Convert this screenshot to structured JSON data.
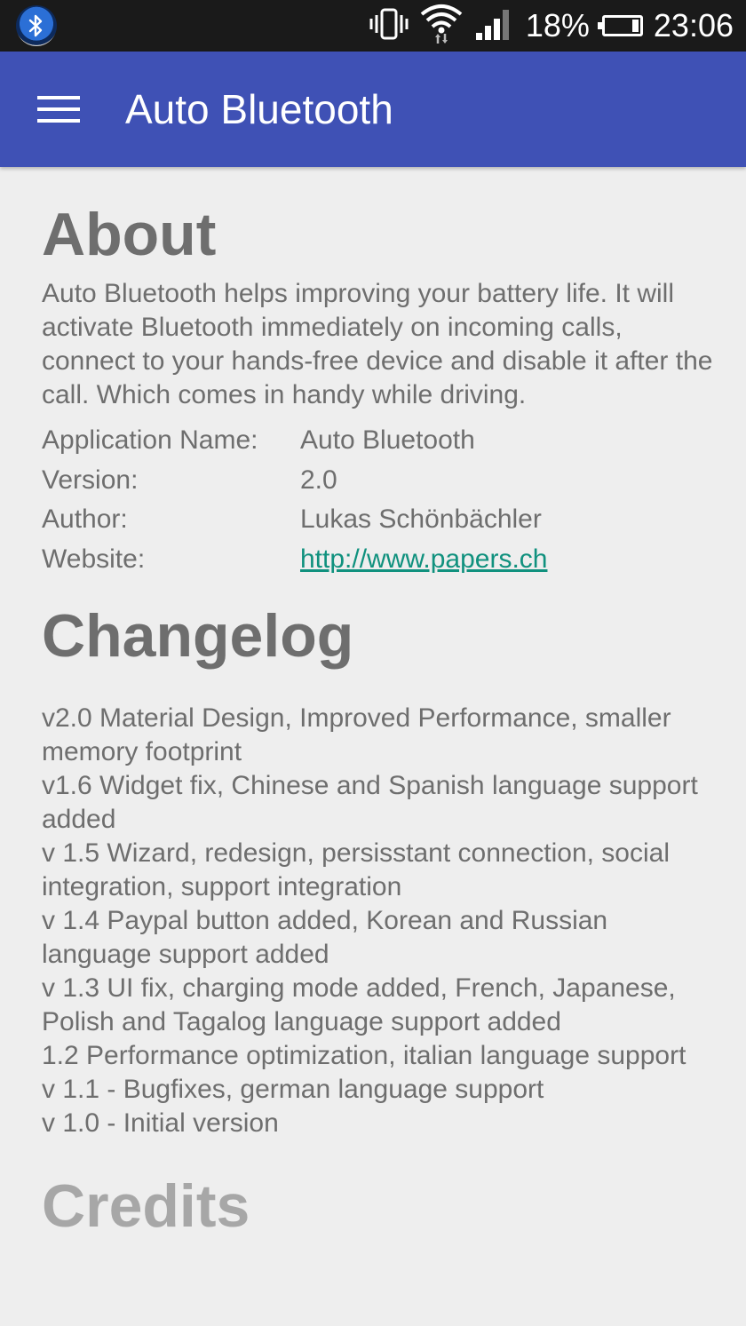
{
  "statusbar": {
    "battery_percent": "18%",
    "time": "23:06"
  },
  "appbar": {
    "title": "Auto Bluetooth"
  },
  "about": {
    "heading": "About",
    "description": "Auto Bluetooth helps improving your battery life. It will activate Bluetooth immediately on incoming calls, connect to your hands-free device and disable it after the call. Which comes in handy while driving.",
    "rows": [
      {
        "label": "Application Name:",
        "value": "Auto Bluetooth"
      },
      {
        "label": "Version:",
        "value": "2.0"
      },
      {
        "label": "Author:",
        "value": "Lukas Schönbächler"
      },
      {
        "label": "Website:",
        "value": "http://www.papers.ch"
      }
    ]
  },
  "changelog": {
    "heading": "Changelog",
    "entries": [
      "v2.0 Material Design, Improved Performance, smaller memory footprint",
      "v1.6 Widget fix, Chinese and Spanish language support added",
      "v 1.5 Wizard, redesign, persisstant connection, social integration, support integration",
      "v 1.4 Paypal button added, Korean and Russian language support added",
      "v 1.3 UI fix, charging mode added, French, Japanese, Polish and Tagalog language support added",
      "1.2 Performance optimization, italian language support",
      "v 1.1 - Bugfixes, german language support",
      "v 1.0 - Initial version"
    ]
  },
  "credits": {
    "heading": "Credits"
  },
  "colors": {
    "appbar": "#3f51b5",
    "background": "#eeeeee",
    "text": "#6e6e6e",
    "link": "#10917e"
  }
}
